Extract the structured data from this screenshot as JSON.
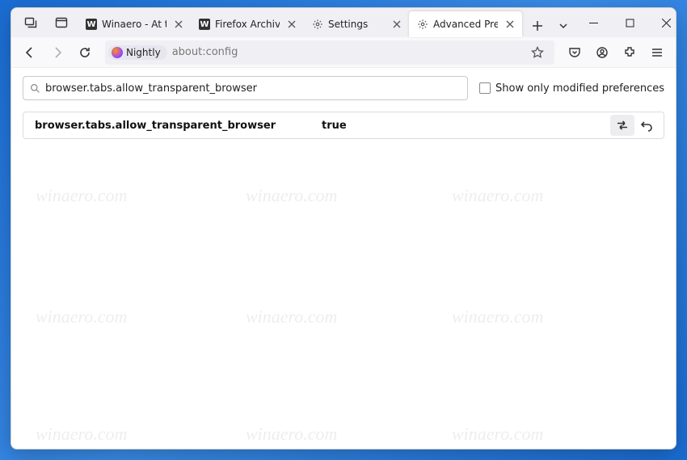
{
  "tabs": [
    {
      "label": "Winaero - At the edge o",
      "icon": "W"
    },
    {
      "label": "Firefox Archives - Winae",
      "icon": "W"
    },
    {
      "label": "Settings",
      "icon": "gear"
    },
    {
      "label": "Advanced Preferences",
      "icon": "gear",
      "active": true
    }
  ],
  "urlbar": {
    "badge": "Nightly",
    "url": "about:config"
  },
  "search": {
    "value": "browser.tabs.allow_transparent_browser",
    "show_only_modified_label": "Show only modified preferences"
  },
  "result": {
    "name": "browser.tabs.allow_transparent_browser",
    "value": "true"
  },
  "watermark_text": "winaero.com"
}
